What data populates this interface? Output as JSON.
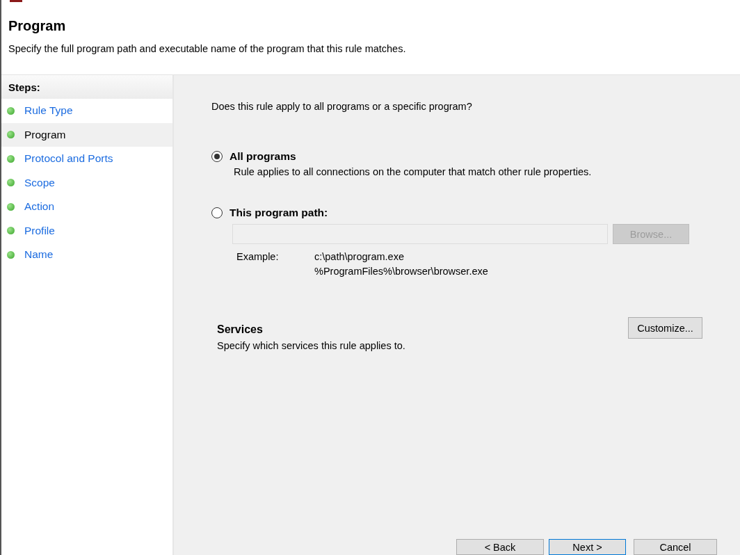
{
  "header": {
    "title": "Program",
    "description": "Specify the full program path and executable name of the program that this rule matches."
  },
  "steps": {
    "title": "Steps:",
    "items": [
      {
        "label": "Rule Type",
        "selected": false
      },
      {
        "label": "Program",
        "selected": true
      },
      {
        "label": "Protocol and Ports",
        "selected": false
      },
      {
        "label": "Scope",
        "selected": false
      },
      {
        "label": "Action",
        "selected": false
      },
      {
        "label": "Profile",
        "selected": false
      },
      {
        "label": "Name",
        "selected": false
      }
    ]
  },
  "question": "Does this rule apply to all programs or a specific program?",
  "options": [
    {
      "kind": "plain",
      "label": "All programs",
      "selected": true,
      "description": "Rule applies to all connections on the computer that match other rule properties."
    },
    {
      "kind": "path",
      "label": "This program path:",
      "selected": false,
      "path": {
        "disabled": true,
        "browse_label": "Browse...",
        "example_label": "Example:",
        "examples": [
          "c:\\path\\program.exe",
          "%ProgramFiles%\\browser\\browser.exe"
        ]
      }
    }
  ],
  "services": {
    "title": "Services",
    "description": "Specify which services this rule applies to.",
    "button": "Customize..."
  },
  "buttons": [
    {
      "label": "< Back",
      "focused": false
    },
    {
      "label": "Next >",
      "focused": true
    },
    {
      "label": "Cancel",
      "focused": false
    }
  ]
}
